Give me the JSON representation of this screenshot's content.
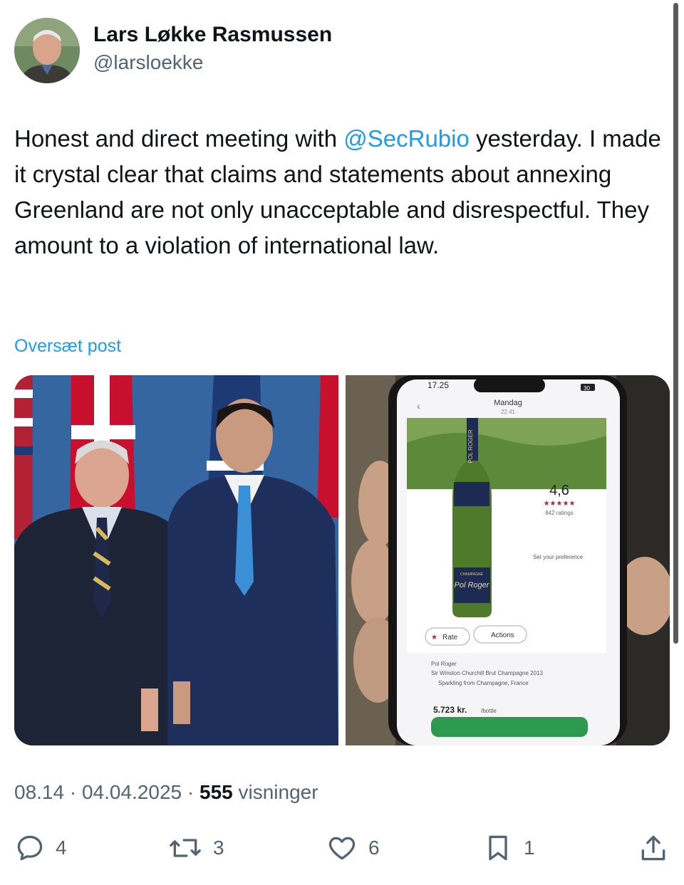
{
  "author": {
    "name": "Lars Løkke Rasmussen",
    "handle": "@larsloekke"
  },
  "tweet": {
    "text_before": "Honest and direct meeting with ",
    "mention": "@SecRubio",
    "text_after": " yesterday. I made it crystal clear that claims and statements about annexing Greenland are not only unacceptable and disrespectful. They amount to a violation of international law."
  },
  "translate_label": "Oversæt post",
  "phone": {
    "time": "17.25",
    "battery": "30",
    "header_day": "Mandag",
    "header_time": "22.41",
    "rating": "4,6",
    "stars": "★★★★★",
    "ratings_count": "842 ratings",
    "set_preference": "Set your preference",
    "rate_label": "Rate",
    "actions_label": "Actions",
    "producer": "Pol Roger",
    "wine_name": "Sir Winston Churchill Brut Champagne 2013",
    "origin": "Sparkling from Champagne, France",
    "price": "5.723 kr.",
    "price_unit": "/bottle",
    "bottle_label_top": "POL ROGER",
    "bottle_label_main": "Pol Roger",
    "bottle_label_sub": "CHAMPAGNE"
  },
  "meta": {
    "time": "08.14",
    "date": "04.04.2025",
    "views_count": "555",
    "views_label": "visninger"
  },
  "actions": {
    "replies": "4",
    "reposts": "3",
    "likes": "6",
    "bookmarks": "1"
  },
  "colors": {
    "accent": "#1d9bf0",
    "text": "#0f1419",
    "secondary": "#536471"
  }
}
